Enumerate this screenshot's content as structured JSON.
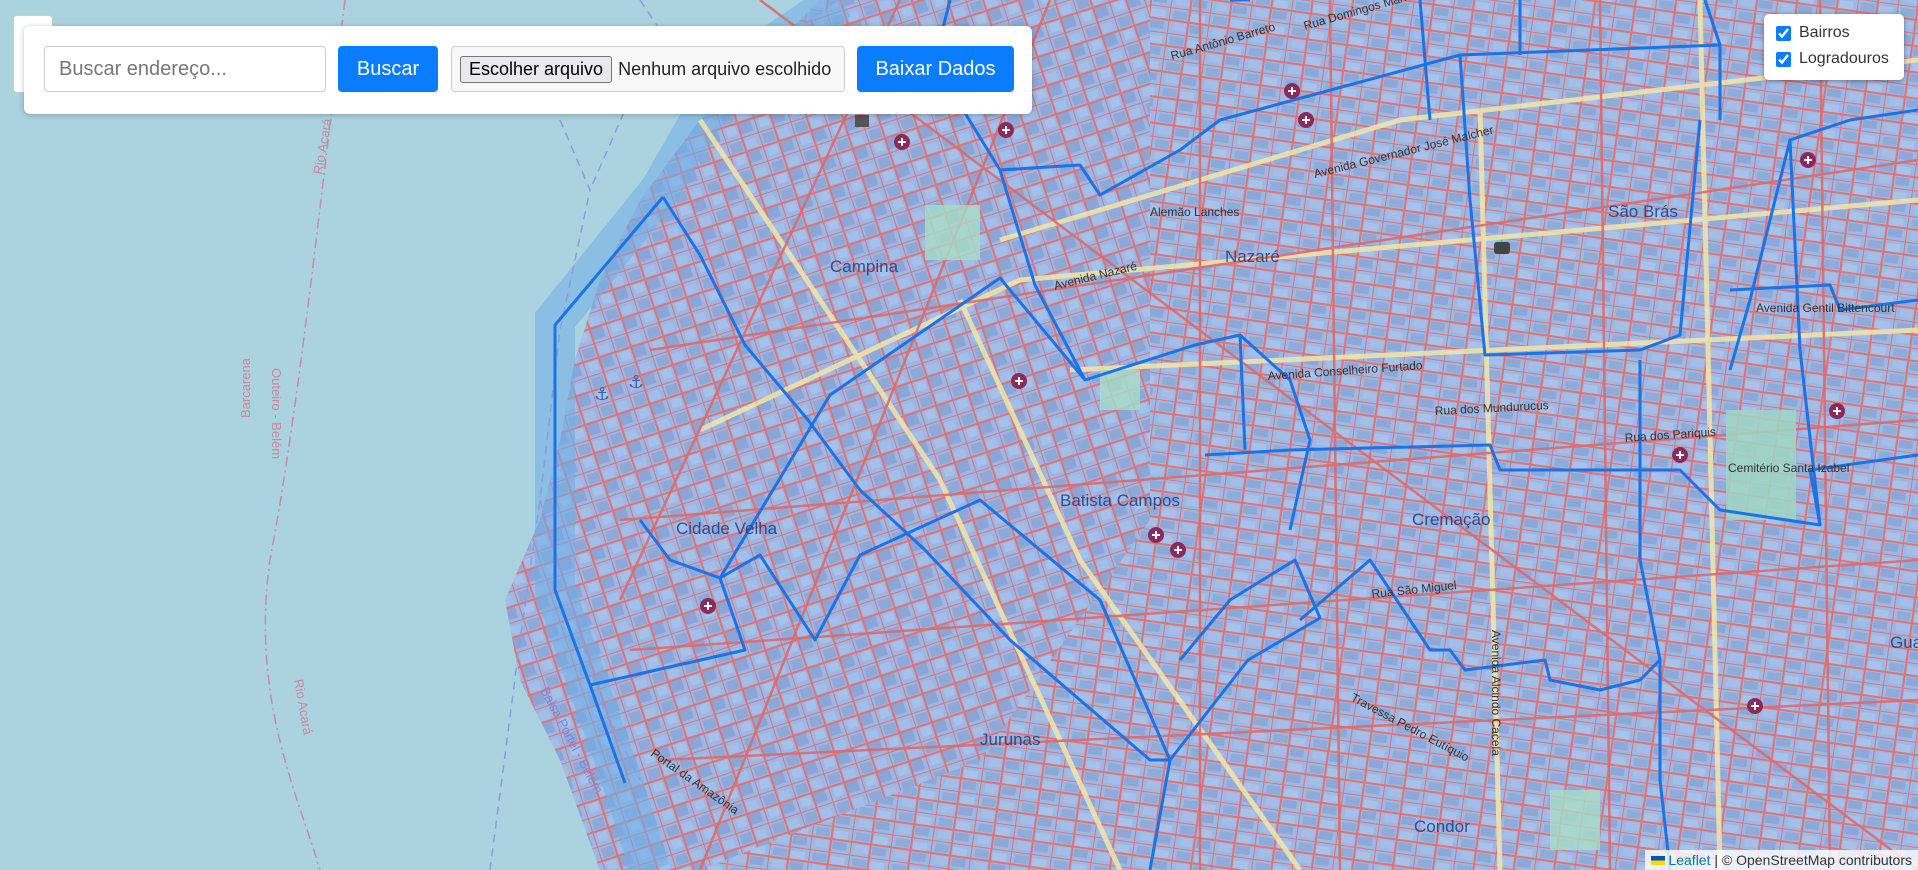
{
  "toolbar": {
    "search_placeholder": "Buscar endereço...",
    "search_button": "Buscar",
    "file_button": "Escolher arquivo",
    "file_status": "Nenhum arquivo escolhido",
    "download_button": "Baixar Dados"
  },
  "layers": [
    {
      "label": "Bairros",
      "checked": true
    },
    {
      "label": "Logradouros",
      "checked": true
    }
  ],
  "attribution": {
    "leaflet": "Leaflet",
    "separator": " | © ",
    "osm": "OpenStreetMap contributors"
  },
  "map_labels": {
    "campina": "Campina",
    "nazare": "Nazaré",
    "sao_bras": "São Brás",
    "cidade_velha": "Cidade Velha",
    "batista_campos": "Batista Campos",
    "cremacao": "Cremação",
    "jurunas": "Jurunas",
    "condor": "Condor",
    "guama": "Guamá",
    "cemiterio": "Cemitério Santa Izabel",
    "alemao": "Alemão Lanches",
    "av_nazare": "Avenida Nazaré",
    "av_conselheiro": "Avenida Conselheiro Furtado",
    "av_gov": "Avenida Governador José Malcher",
    "rua_mundurucus": "Rua dos Mundurucus",
    "rua_pariquis": "Rua dos Pariquis",
    "av_alcindo": "Avenida Alcindo Cacela",
    "rio_acara": "Rio Acará",
    "outeiro": "Outeiro - Belém",
    "barcarena": "Barcarena",
    "balsa": "Balsa Portel - Belém",
    "pedro": "Travessa Pedro Eutíquio",
    "ruy": "Rua Antônio Barreto",
    "domingos": "Rua Domingos Marreiros",
    "gentil": "Avenida Gentil Bittencourt",
    "sao_miguel": "Rua São Miguel",
    "amazonia": "Portal da Amazônia"
  },
  "colors": {
    "water": "#aad3df",
    "land_overlay": "#8fb3ea",
    "street": "#e06a6a",
    "boundary": "#1a73e8",
    "accent": "#0a7cff"
  },
  "icons": [
    "hospital-icon",
    "anchor-icon",
    "binoculars-icon",
    "museum-icon"
  ]
}
